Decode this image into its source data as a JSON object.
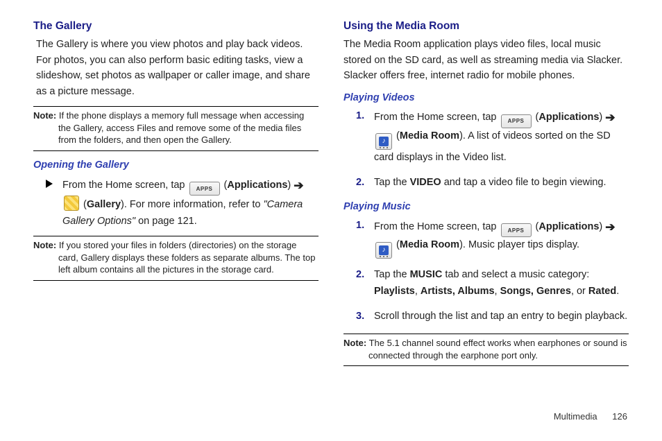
{
  "left": {
    "title": "The Gallery",
    "intro": "The Gallery is where you view photos and play back videos. For photos, you can also perform basic editing tasks, view a slideshow, set photos as wallpaper or caller image, and share as a picture message.",
    "note1_label": "Note:",
    "note1_text": " If the phone displays a memory full message when accessing the Gallery, access Files and remove some of the media files from the folders, and then open the Gallery.",
    "sub1_title": "Opening the Gallery",
    "open": {
      "pre": "From the Home screen, tap ",
      "apps": "APPS",
      "applications": "Applications",
      "gallery": "Gallery",
      "post1": "). For more information, refer to ",
      "ref": "\"Camera Gallery Options\"",
      "post2": "  on page 121."
    },
    "note2_label": "Note:",
    "note2_text": " If you stored your files in folders (directories) on the storage card, Gallery displays these folders as separate albums. The top left album contains all the pictures in the storage card."
  },
  "right": {
    "title": "Using the Media Room",
    "intro": "The Media Room application plays video files, local music stored on the SD card, as well as streaming media via Slacker. Slacker offers free, internet radio for mobile phones.",
    "sub_v": "Playing Videos",
    "video": {
      "step1_pre": "From the Home screen, tap ",
      "apps": "APPS",
      "applications": "Applications",
      "media_room": "Media Room",
      "step1_post": "). A list of videos sorted on the SD card displays in the Video list.",
      "step2_pre": "Tap the ",
      "tab": "VIDEO",
      "step2_post": " and tap a video file to begin viewing."
    },
    "sub_m": "Playing Music",
    "music": {
      "step1_pre": "From the Home screen, tap ",
      "apps": "APPS",
      "applications": "Applications",
      "media_room": "Media Room",
      "step1_post": "). Music player tips display.",
      "step2_pre": "Tap the ",
      "tab": "MUSIC",
      "step2_mid": "  tab and select a music category: ",
      "cat1": "Playlists",
      "cat2": "Artists, Albums",
      "cat3": "Songs, Genres",
      "or": ", or ",
      "cat4": "Rated",
      "step3": "Scroll through the list and tap an entry to begin playback."
    },
    "note_label": "Note:",
    "note_text": " The 5.1 channel sound effect works when earphones or sound is connected through the earphone port only."
  },
  "footer": {
    "section": "Multimedia",
    "page": "126"
  }
}
